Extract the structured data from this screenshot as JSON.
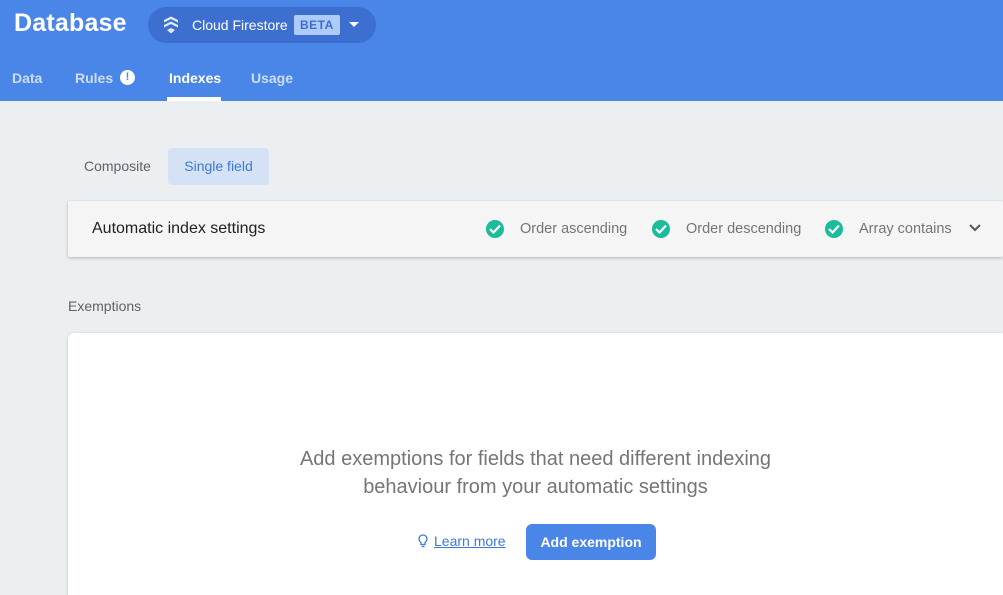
{
  "header": {
    "title": "Database",
    "db_selector": {
      "name": "Cloud Firestore",
      "badge": "BETA"
    },
    "tabs": [
      {
        "label": "Data"
      },
      {
        "label": "Rules",
        "badge": "!"
      },
      {
        "label": "Indexes",
        "active": true
      },
      {
        "label": "Usage"
      }
    ]
  },
  "index_types": {
    "composite_label": "Composite",
    "single_field_label": "Single field",
    "selected": "Single field"
  },
  "automatic_settings": {
    "title": "Automatic index settings",
    "items": [
      {
        "label": "Order ascending",
        "icon": "check-circle-icon"
      },
      {
        "label": "Order descending",
        "icon": "check-circle-icon"
      },
      {
        "label": "Array contains",
        "icon": "check-circle-icon"
      }
    ]
  },
  "exemptions": {
    "section_label": "Exemptions",
    "empty_line1": "Add exemptions for fields that need different indexing",
    "empty_line2": "behaviour from your automatic settings",
    "learn_more": "Learn more",
    "add_button": "Add exemption"
  },
  "colors": {
    "header": "#4a86e8",
    "accent": "#4a86e8",
    "check": "#1abc9c"
  }
}
